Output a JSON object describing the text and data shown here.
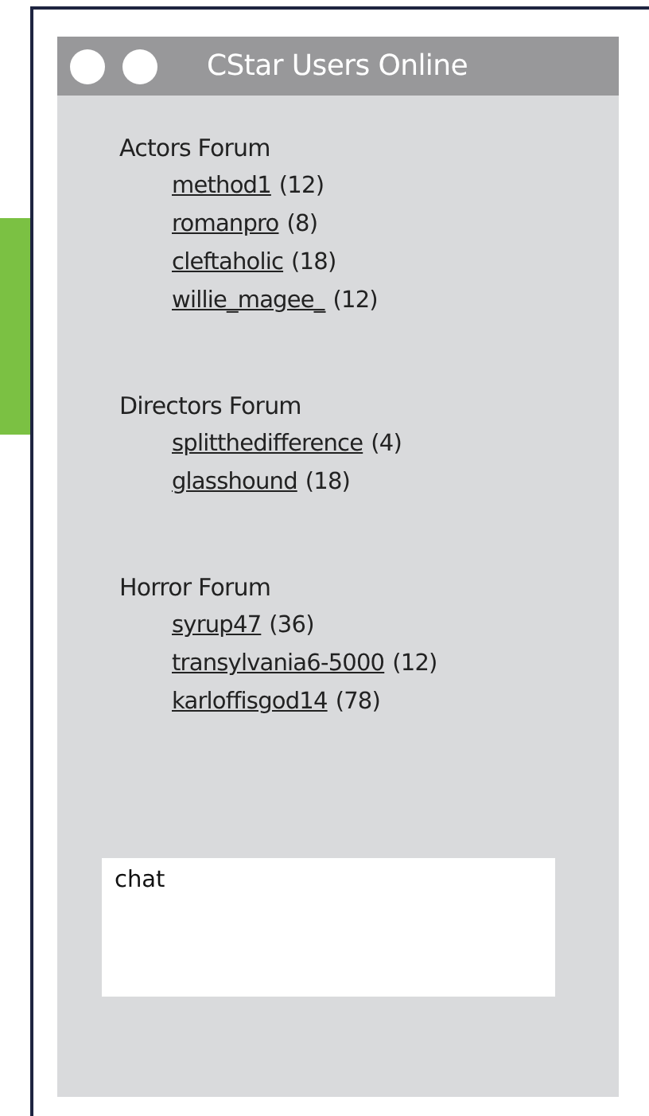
{
  "window": {
    "title": "CStar Users Online"
  },
  "forums": [
    {
      "name": "Actors Forum",
      "users": [
        {
          "name": "method1",
          "count": "(12)"
        },
        {
          "name": "romanpro",
          "count": "(8)"
        },
        {
          "name": "cleftaholic",
          "count": "(18)"
        },
        {
          "name": "willie_magee_",
          "count": "(12)"
        }
      ]
    },
    {
      "name": "Directors Forum",
      "users": [
        {
          "name": "splitthedifference",
          "count": "(4)"
        },
        {
          "name": "glasshound",
          "count": "(18)"
        }
      ]
    },
    {
      "name": "Horror Forum",
      "users": [
        {
          "name": "syrup47",
          "count": "(36)"
        },
        {
          "name": "transylvania6-5000",
          "count": "(12)"
        },
        {
          "name": "karloffisgod14",
          "count": "(78)"
        }
      ]
    }
  ],
  "chat": {
    "placeholder": "chat"
  }
}
